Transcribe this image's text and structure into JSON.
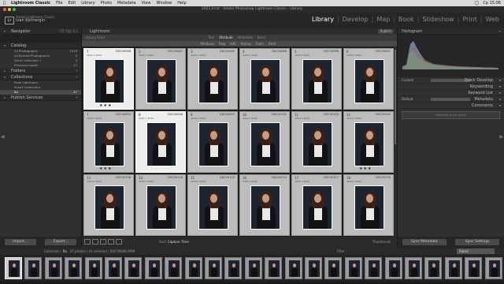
{
  "menubar": {
    "app": "Lightroom Classic",
    "items": [
      "File",
      "Edit",
      "Library",
      "Photo",
      "Metadata",
      "View",
      "Window",
      "Help"
    ],
    "status": [
      "Cp 15:06"
    ]
  },
  "window_title": "2021.lrcat - Adobe Photoshop Lightroom Classic - Library",
  "identity": {
    "logo": "Lr",
    "brand": "Adobe Lightroom Classic",
    "user": "Ivan Kochergin"
  },
  "modules": [
    "Library",
    "Develop",
    "Map",
    "Book",
    "Slideshow",
    "Print",
    "Web"
  ],
  "active_module": "Library",
  "left_panel": {
    "navigator": {
      "title": "Navigator",
      "zoom": "FIT FILL 1:1"
    },
    "catalog": {
      "title": "Catalog",
      "items": [
        {
          "label": "All Photographs",
          "count": "1026"
        },
        {
          "label": "All Synced Photographs",
          "count": "0"
        },
        {
          "label": "Quick Collection +",
          "count": "0"
        },
        {
          "label": "Previous Import",
          "count": "47"
        }
      ]
    },
    "folders": {
      "title": "Folders"
    },
    "collections": {
      "title": "Collections",
      "items": [
        {
          "label": "From Lightroom",
          "count": ""
        },
        {
          "label": "Smart Collections",
          "count": ""
        },
        {
          "label": "Ra",
          "count": "47"
        }
      ]
    },
    "publish": {
      "title": "Publish Services"
    },
    "import_label": "Import...",
    "export_label": "Export..."
  },
  "center": {
    "header": "Lightroom",
    "publish_btn": "Publish",
    "filter_bar": {
      "label": "Library Filter :",
      "tabs": [
        "Text",
        "Attribute",
        "Metadata",
        "None"
      ],
      "active": "Attribute",
      "attr": [
        "Attribute",
        "Flag",
        "Edit",
        "Rating",
        "Color",
        "Kind"
      ]
    },
    "grid": [
      {
        "num": "7",
        "name": "DSC00098",
        "dim": "4000 x 6000",
        "stars": 3,
        "selected": true,
        "focus": true
      },
      {
        "num": "2",
        "name": "DSC00081",
        "dim": "4000 x 6000",
        "stars": 0,
        "selected": false
      },
      {
        "num": "3",
        "name": "DSC00084",
        "dim": "4000 x 6000",
        "stars": 0,
        "selected": false
      },
      {
        "num": "4",
        "name": "DSC00086",
        "dim": "4000 x 6000",
        "stars": 0,
        "selected": false
      },
      {
        "num": "5",
        "name": "DSC00088",
        "dim": "4000 x 6000",
        "stars": 0,
        "selected": false
      },
      {
        "num": "6",
        "name": "DSC00091",
        "dim": "4000 x 6000",
        "stars": 0,
        "selected": false
      },
      {
        "num": "7",
        "name": "DSC00093",
        "dim": "4000 x 6000",
        "stars": 3,
        "selected": false
      },
      {
        "num": "8",
        "name": "DSC00096",
        "dim": "2251 x 3016",
        "stars": 0,
        "selected": false,
        "focus": true
      },
      {
        "num": "9",
        "name": "DSC00097",
        "dim": "4000 x 6000",
        "stars": 0,
        "selected": false
      },
      {
        "num": "10",
        "name": "DSC00101",
        "dim": "4000 x 6000",
        "stars": 0,
        "selected": false
      },
      {
        "num": "11",
        "name": "DSC00103",
        "dim": "4000 x 6000",
        "stars": 0,
        "selected": false
      },
      {
        "num": "12",
        "name": "DSC00105",
        "dim": "4000 x 6000",
        "stars": 3,
        "selected": false
      },
      {
        "num": "13",
        "name": "DSC00108",
        "dim": "4000 x 6000",
        "stars": 0,
        "selected": false
      },
      {
        "num": "14",
        "name": "DSC00118",
        "dim": "4000 x 6000",
        "stars": 0,
        "selected": false
      },
      {
        "num": "15",
        "name": "DSC00119",
        "dim": "4000 x 6000",
        "stars": 0,
        "selected": false
      },
      {
        "num": "16",
        "name": "DSC00124",
        "dim": "4000 x 6000",
        "stars": 0,
        "selected": false
      },
      {
        "num": "17",
        "name": "DSC00127",
        "dim": "4000 x 6000",
        "stars": 0,
        "selected": false
      },
      {
        "num": "18",
        "name": "DSC00130",
        "dim": "4000 x 6000",
        "stars": 0,
        "selected": false
      }
    ]
  },
  "toolbar": {
    "sort_label": "Sort:",
    "sort_value": "Capture Time",
    "thumbs_label": "Thumbnails"
  },
  "right_panel": {
    "histogram": "Histogram",
    "quick_develop": {
      "label": "Quick Develop",
      "preset": "Custom"
    },
    "keywording": "Keywording",
    "keyword_list": "Keyword List",
    "metadata": {
      "label": "Metadata",
      "preset": "Default"
    },
    "comments": "Comments",
    "comments_note": "Collection is not public",
    "sync_metadata": "Sync Metadata",
    "sync_settings": "Sync Settings"
  },
  "filmstrip_bar": {
    "source_label": "Collection :",
    "source": "Ra",
    "summary": "47 photos / 41 selected / DSC00098.ARW",
    "filter_label": "Filter :",
    "filter_value": "Rated"
  },
  "colors": {
    "accent": "#ffffff",
    "panel": "#303030",
    "grid_bg": "#1e1e1e",
    "cell": "#bdbdbd"
  }
}
